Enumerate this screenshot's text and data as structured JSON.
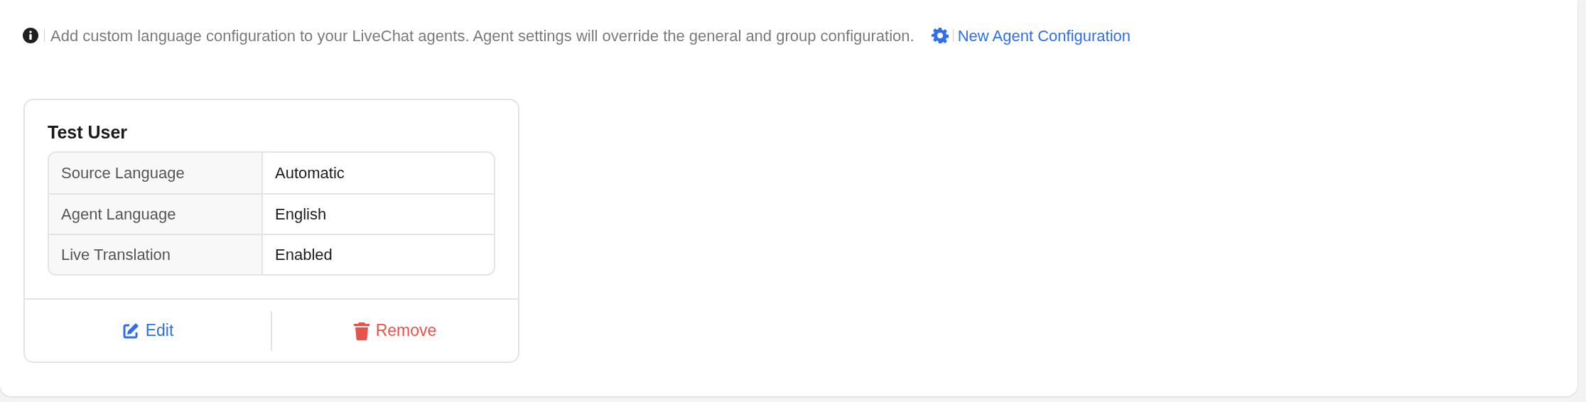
{
  "notice": {
    "text": "Add custom language configuration to your LiveChat agents. Agent settings will override the general and group configuration.",
    "link": "New Agent Configuration"
  },
  "cards": [
    {
      "title": "Test User",
      "rows": [
        {
          "label": "Source Language",
          "value": "Automatic"
        },
        {
          "label": "Agent Language",
          "value": "English"
        },
        {
          "label": "Live Translation",
          "value": "Enabled"
        }
      ],
      "actions": [
        {
          "kind": "edit",
          "label": "Edit"
        },
        {
          "kind": "remove",
          "label": "Remove"
        }
      ]
    }
  ]
}
